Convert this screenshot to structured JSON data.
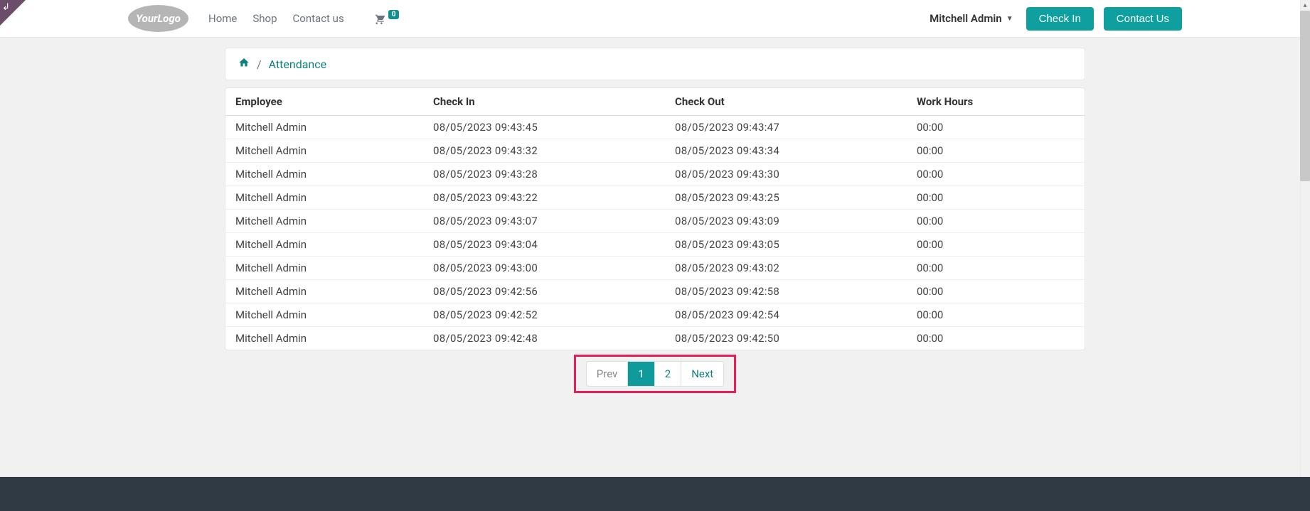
{
  "corner_icon": "↲",
  "logo": {
    "text1": "Your",
    "text2": "Logo"
  },
  "nav": {
    "home": "Home",
    "shop": "Shop",
    "contact": "Contact us"
  },
  "cart": {
    "count": "0"
  },
  "user": {
    "name": "Mitchell Admin"
  },
  "buttons": {
    "checkin": "Check In",
    "contact_us": "Contact Us"
  },
  "breadcrumb": {
    "home_icon": "⌂",
    "attendance": "Attendance",
    "sep": "/"
  },
  "table": {
    "headers": {
      "employee": "Employee",
      "checkin": "Check In",
      "checkout": "Check Out",
      "hours": "Work Hours"
    },
    "rows": [
      {
        "emp": "Mitchell Admin",
        "in": "08/05/2023  09:43:45",
        "out": "08/05/2023  09:43:47",
        "hrs": "00:00"
      },
      {
        "emp": "Mitchell Admin",
        "in": "08/05/2023  09:43:32",
        "out": "08/05/2023  09:43:34",
        "hrs": "00:00"
      },
      {
        "emp": "Mitchell Admin",
        "in": "08/05/2023  09:43:28",
        "out": "08/05/2023  09:43:30",
        "hrs": "00:00"
      },
      {
        "emp": "Mitchell Admin",
        "in": "08/05/2023  09:43:22",
        "out": "08/05/2023  09:43:25",
        "hrs": "00:00"
      },
      {
        "emp": "Mitchell Admin",
        "in": "08/05/2023  09:43:07",
        "out": "08/05/2023  09:43:09",
        "hrs": "00:00"
      },
      {
        "emp": "Mitchell Admin",
        "in": "08/05/2023  09:43:04",
        "out": "08/05/2023  09:43:05",
        "hrs": "00:00"
      },
      {
        "emp": "Mitchell Admin",
        "in": "08/05/2023  09:43:00",
        "out": "08/05/2023  09:43:02",
        "hrs": "00:00"
      },
      {
        "emp": "Mitchell Admin",
        "in": "08/05/2023  09:42:56",
        "out": "08/05/2023  09:42:58",
        "hrs": "00:00"
      },
      {
        "emp": "Mitchell Admin",
        "in": "08/05/2023  09:42:52",
        "out": "08/05/2023  09:42:54",
        "hrs": "00:00"
      },
      {
        "emp": "Mitchell Admin",
        "in": "08/05/2023  09:42:48",
        "out": "08/05/2023  09:42:50",
        "hrs": "00:00"
      }
    ]
  },
  "pagination": {
    "prev": "Prev",
    "p1": "1",
    "p2": "2",
    "next": "Next"
  }
}
